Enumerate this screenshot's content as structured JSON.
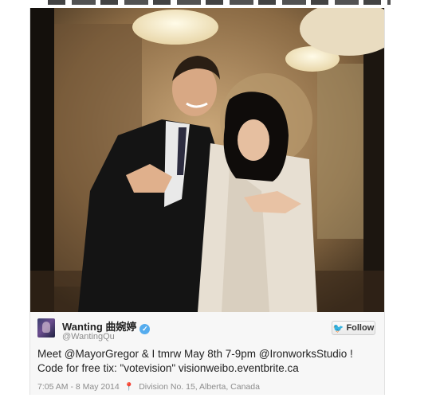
{
  "tweet": {
    "display_name": "Wanting 曲婉婷",
    "handle": "@WantingQu",
    "follow_label": "Follow",
    "text_line1": "Meet @MayorGregor & I tmrw May 8th 7-9pm @IronworksStudio !",
    "text_line2": "Code for free tix: \"votevision\" visionweibo.eventbrite.ca",
    "timestamp": "7:05 AM - 8 May 2014",
    "location": "Division No. 15, Alberta, Canada"
  },
  "icons": {
    "verified": "verified-badge-icon",
    "bird": "twitter-bird-icon",
    "location": "map-pin-icon"
  },
  "colors": {
    "twitter_blue": "#55acee",
    "text": "#222222",
    "muted": "#8c8c8c"
  }
}
